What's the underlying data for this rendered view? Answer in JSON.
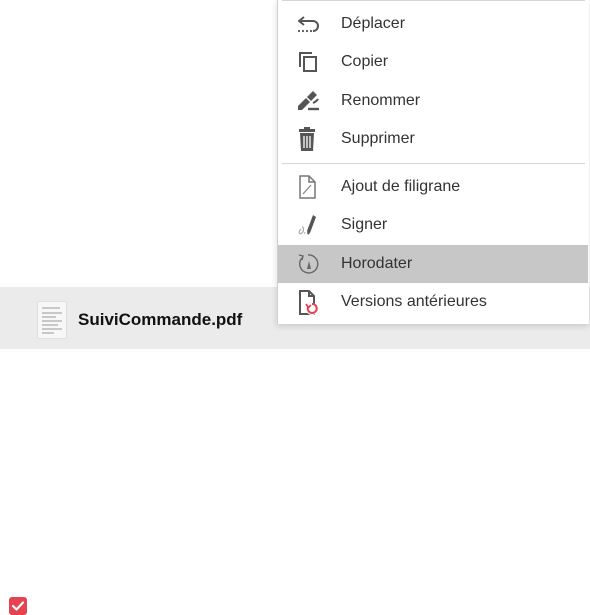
{
  "menu": {
    "items": [
      {
        "label": "Déplacer",
        "icon": "move-icon"
      },
      {
        "label": "Copier",
        "icon": "copy-icon"
      },
      {
        "label": "Renommer",
        "icon": "rename-icon"
      },
      {
        "label": "Supprimer",
        "icon": "trash-icon"
      },
      {
        "label": "Ajout de filigrane",
        "icon": "watermark-icon"
      },
      {
        "label": "Signer",
        "icon": "sign-icon"
      },
      {
        "label": "Horodater",
        "icon": "timestamp-icon",
        "highlighted": true
      },
      {
        "label": "Versions antérieures",
        "icon": "version-history-icon"
      }
    ]
  },
  "file": {
    "name": "SuiviCommande.pdf",
    "checked": true
  },
  "colors": {
    "accent": "#e4434f",
    "highlight": "#c7c7c7",
    "icon": "#555555"
  }
}
